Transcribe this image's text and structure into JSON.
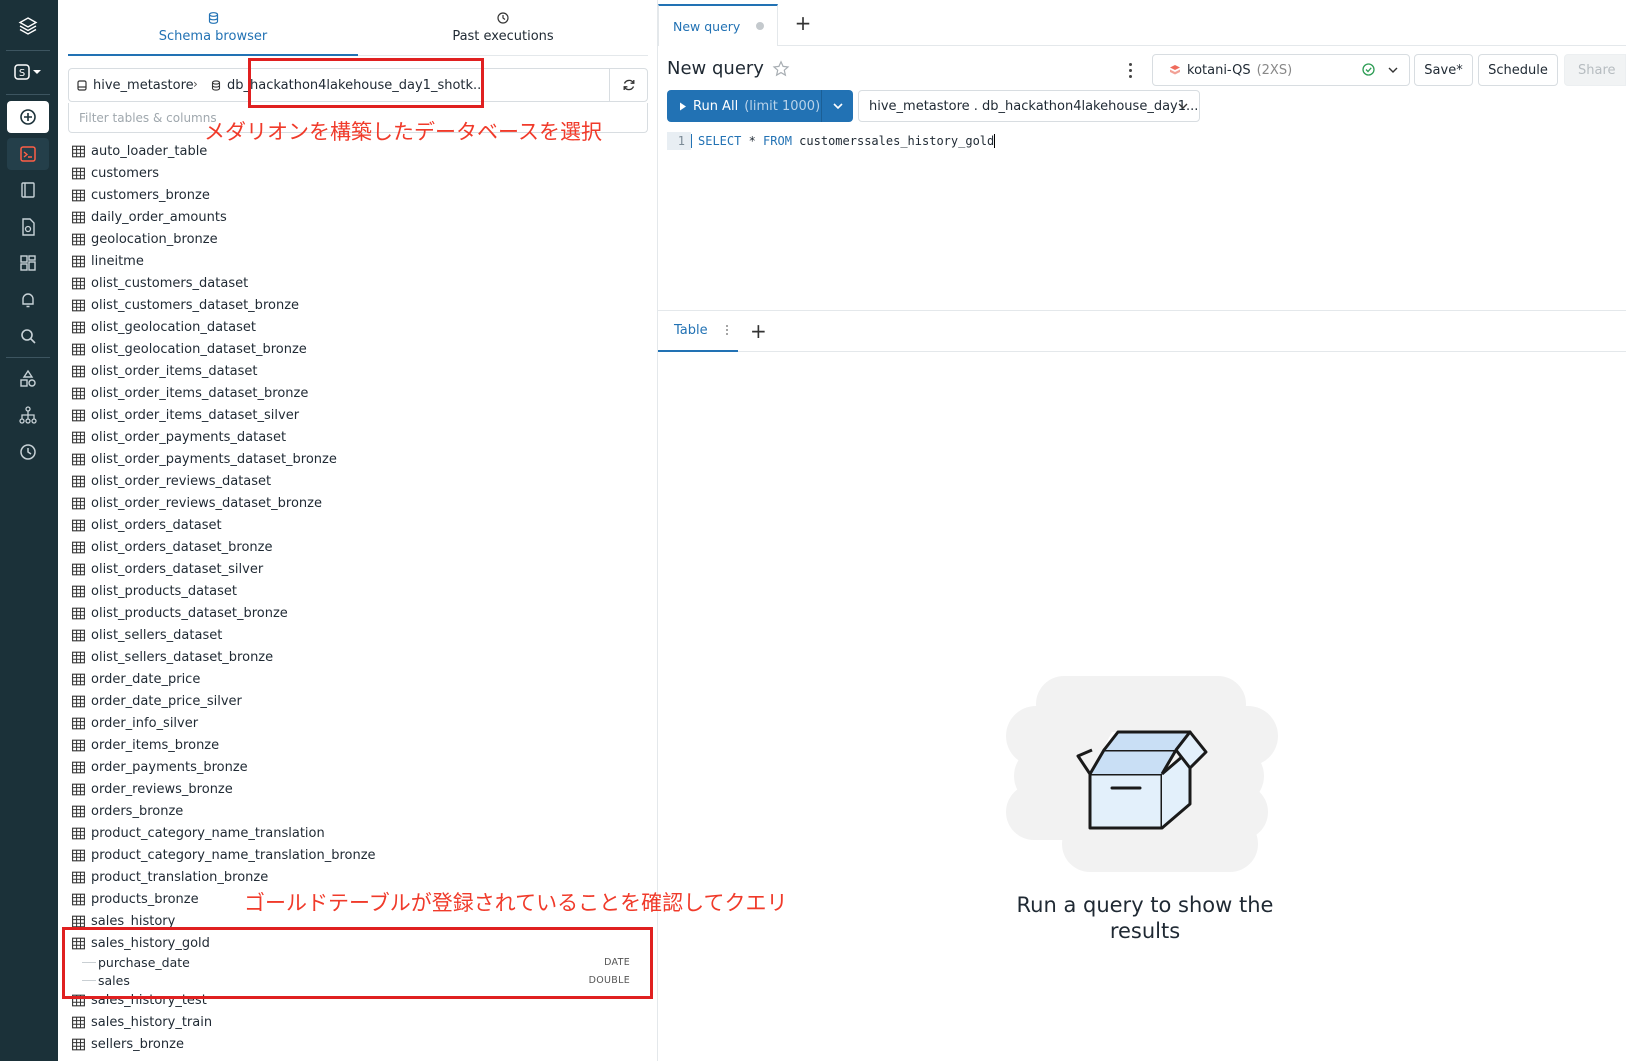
{
  "panel": {
    "tabs": [
      {
        "label": "Schema browser"
      },
      {
        "label": "Past executions"
      }
    ],
    "catalog": "hive_metastore",
    "database": "db_hackathon4lakehouse_day1_shotk...",
    "filter_placeholder": "Filter tables & columns",
    "tables_before": [
      "auto_loader_table",
      "customers",
      "customers_bronze",
      "daily_order_amounts",
      "geolocation_bronze",
      "lineitme",
      "olist_customers_dataset",
      "olist_customers_dataset_bronze",
      "olist_geolocation_dataset",
      "olist_geolocation_dataset_bronze",
      "olist_order_items_dataset",
      "olist_order_items_dataset_bronze",
      "olist_order_items_dataset_silver",
      "olist_order_payments_dataset",
      "olist_order_payments_dataset_bronze",
      "olist_order_reviews_dataset",
      "olist_order_reviews_dataset_bronze",
      "olist_orders_dataset",
      "olist_orders_dataset_bronze",
      "olist_orders_dataset_silver",
      "olist_products_dataset",
      "olist_products_dataset_bronze",
      "olist_sellers_dataset",
      "olist_sellers_dataset_bronze",
      "order_date_price",
      "order_date_price_silver",
      "order_info_silver",
      "order_items_bronze",
      "order_payments_bronze",
      "order_reviews_bronze",
      "orders_bronze",
      "product_category_name_translation",
      "product_category_name_translation_bronze",
      "product_translation_bronze",
      "products_bronze",
      "sales_history"
    ],
    "expanded_table": {
      "name": "sales_history_gold",
      "columns": [
        {
          "name": "purchase_date",
          "type": "DATE"
        },
        {
          "name": "sales",
          "type": "DOUBLE"
        }
      ]
    },
    "tables_after": [
      "sales_history_test",
      "sales_history_train",
      "sellers_bronze"
    ]
  },
  "annotations": {
    "database_note": "メダリオンを構築したデータベースを選択",
    "table_note": "ゴールドテーブルが登録されていることを確認してクエリ"
  },
  "editor": {
    "tab_label": "New query",
    "title": "New query",
    "warehouse_name": "kotani-QS",
    "warehouse_size": "(2XS)",
    "save_label": "Save*",
    "schedule_label": "Schedule",
    "share_label": "Share",
    "run_label": "Run All",
    "run_limit": "(limit 1000)",
    "context": "hive_metastore . db_hackathon4lakehouse_day1...",
    "line_number": "1",
    "sql_keyword1": "SELECT",
    "sql_star": " * ",
    "sql_keyword2": "FROM",
    "sql_rest": " customerssales_history_gold"
  },
  "results": {
    "tab_label": "Table",
    "empty_message": "Run a query to show the results"
  },
  "colors": {
    "rail": "#1b3139",
    "accent": "#2272b4",
    "annotation_red": "#e02020"
  },
  "icons": [
    "databricks-logo-icon",
    "workspace-switch-icon",
    "new-icon",
    "sql-editor-icon",
    "notebook-icon",
    "queries-icon",
    "dashboards-icon",
    "alerts-icon",
    "search-icon",
    "shapes-icon",
    "hierarchy-icon",
    "history-icon",
    "database-icon",
    "clock-icon",
    "table-icon",
    "refresh-icon",
    "star-icon",
    "warehouse-icon",
    "check-circle-icon",
    "chevron-down-icon",
    "play-icon",
    "empty-box-icon"
  ]
}
